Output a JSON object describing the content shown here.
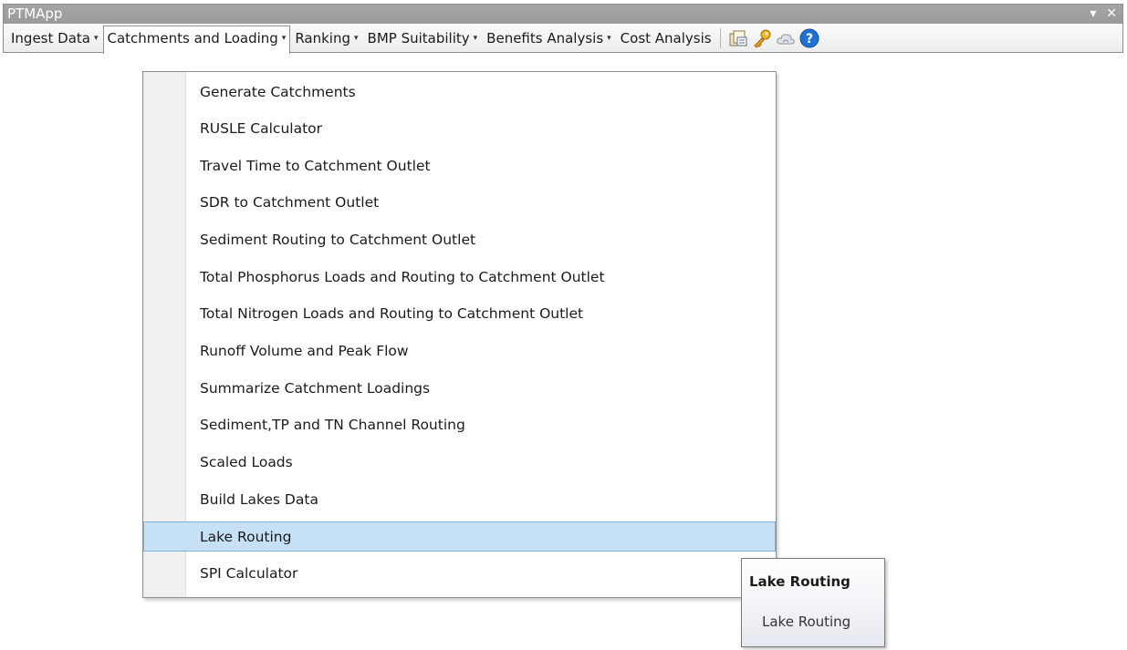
{
  "window": {
    "title": "PTMApp",
    "controls": [
      "▾",
      "✕"
    ]
  },
  "menubar": {
    "menus": [
      {
        "label": "Ingest Data",
        "caret": "▾"
      },
      {
        "label": "Catchments and Loading",
        "caret": "▾",
        "open": true
      },
      {
        "label": "Ranking",
        "caret": "▾"
      },
      {
        "label": "BMP Suitability",
        "caret": "▾"
      },
      {
        "label": "Benefits Analysis",
        "caret": "▾"
      },
      {
        "label": "Cost Analysis",
        "caret": ""
      }
    ],
    "icons": [
      "documents-icon",
      "key-icon",
      "cloud-icon",
      "help-icon"
    ]
  },
  "dropdown": {
    "items": [
      "Generate Catchments",
      "RUSLE Calculator",
      "Travel Time to Catchment Outlet",
      "SDR to Catchment Outlet",
      "Sediment Routing to Catchment Outlet",
      "Total Phosphorus Loads and Routing to Catchment Outlet",
      "Total Nitrogen Loads and Routing to Catchment Outlet",
      "Runoff Volume and Peak Flow",
      "Summarize Catchment Loadings",
      "Sediment,TP and TN Channel Routing",
      "Scaled Loads",
      "Build Lakes Data",
      "Lake Routing",
      "SPI Calculator"
    ],
    "highlighted": "Lake Routing"
  },
  "tooltip": {
    "title": "Lake Routing",
    "body": "Lake Routing"
  },
  "colors": {
    "highlight_bg": "#c6e0f6",
    "highlight_border": "#7fb0de",
    "help_blue": "#1e73d2",
    "key_gold": "#e8a317"
  }
}
